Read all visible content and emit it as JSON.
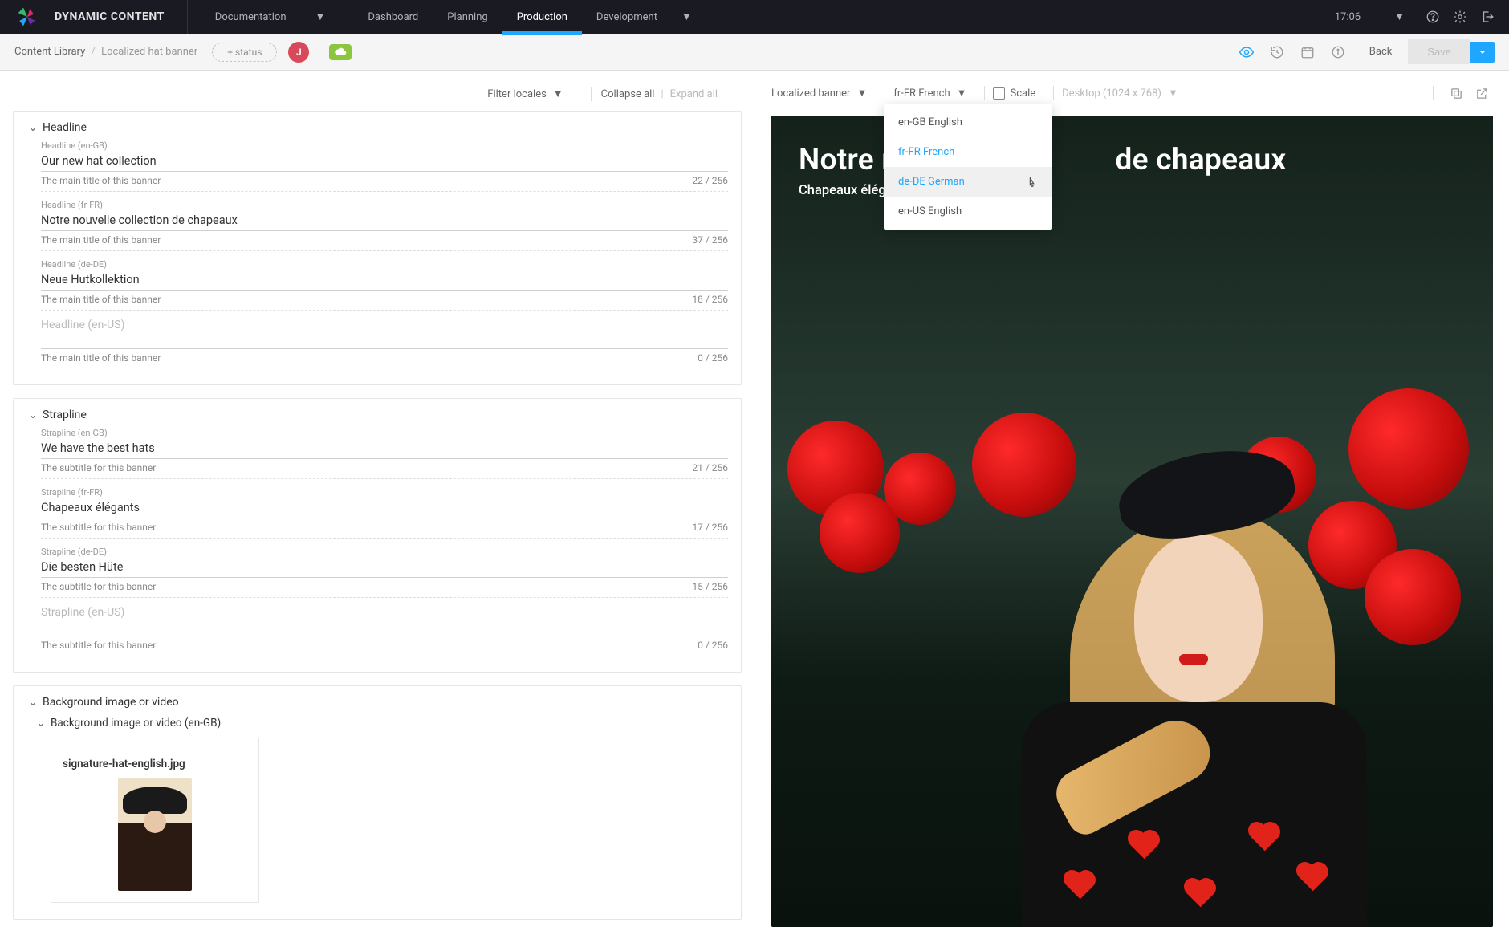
{
  "brand": "DYNAMIC CONTENT",
  "top_dropdown": "Documentation",
  "nav": {
    "dashboard": "Dashboard",
    "planning": "Planning",
    "production": "Production",
    "development": "Development"
  },
  "time": "17:06",
  "breadcrumb": {
    "root": "Content Library",
    "sep": "/",
    "leaf": "Localized hat banner"
  },
  "status_chip": "+ status",
  "avatar_initial": "J",
  "back": "Back",
  "save": "Save",
  "form_toolbar": {
    "filter": "Filter locales",
    "collapse": "Collapse all",
    "expand": "Expand all"
  },
  "sections": {
    "headline": {
      "title": "Headline",
      "fields": [
        {
          "label": "Headline (en-GB)",
          "value": "Our new hat collection",
          "help": "The main title of this banner",
          "count": "22 / 256"
        },
        {
          "label": "Headline (fr-FR)",
          "value": "Notre nouvelle collection de chapeaux",
          "help": "The main title of this banner",
          "count": "37 / 256"
        },
        {
          "label": "Headline (de-DE)",
          "value": "Neue Hutkollektion",
          "help": "The main title of this banner",
          "count": "18 / 256"
        },
        {
          "label": "Headline (en-US)",
          "value": "",
          "help": "The main title of this banner",
          "count": "0 / 256"
        }
      ]
    },
    "strapline": {
      "title": "Strapline",
      "fields": [
        {
          "label": "Strapline (en-GB)",
          "value": "We have the best hats",
          "help": "The subtitle for this banner",
          "count": "21 / 256"
        },
        {
          "label": "Strapline (fr-FR)",
          "value": "Chapeaux élégants",
          "help": "The subtitle for this banner",
          "count": "17 / 256"
        },
        {
          "label": "Strapline (de-DE)",
          "value": "Die besten Hüte",
          "help": "The subtitle for this banner",
          "count": "15 / 256"
        },
        {
          "label": "Strapline (en-US)",
          "value": "",
          "help": "The subtitle for this banner",
          "count": "0 / 256"
        }
      ]
    },
    "background": {
      "title": "Background image or video",
      "subtitle": "Background image or video (en-GB)",
      "media_name": "signature-hat-english.jpg"
    }
  },
  "preview_toolbar": {
    "schema": "Localized banner",
    "locale_selected": "fr-FR French",
    "scale": "Scale",
    "device": "Desktop (1024 x 768)"
  },
  "locale_menu": [
    {
      "label": "en-GB English",
      "state": ""
    },
    {
      "label": "fr-FR French",
      "state": "selected"
    },
    {
      "label": "de-DE German",
      "state": "hovered"
    },
    {
      "label": "en-US English",
      "state": ""
    }
  ],
  "banner": {
    "headline_visible": "Notre nou                        de chapeaux",
    "strapline_visible": "Chapeaux élégant"
  }
}
